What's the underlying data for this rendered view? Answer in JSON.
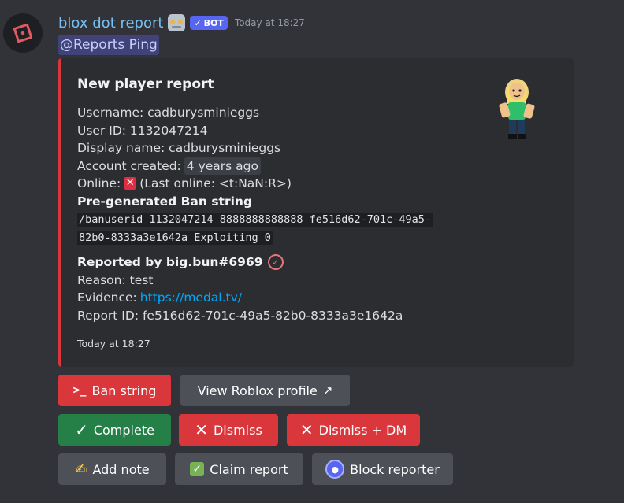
{
  "message": {
    "username": "blox dot report",
    "bot_tag": "BOT",
    "timestamp": "Today at 18:27",
    "mention": "@Reports Ping"
  },
  "embed": {
    "title": "New player report",
    "username_line": "Username: cadburysminieggs",
    "user_id_line": "User ID: 1132047214",
    "display_name_line": "Display name: cadburysminieggs",
    "account_created_label": "Account created:",
    "account_created_value": "4 years ago",
    "online_label": "Online:",
    "online_status": "(Last online: <t:NaN:R>)",
    "ban_field_title": "Pre-generated Ban string",
    "ban_code_line1": "/banuserid 1132047214 8888888888888 fe516d62-701c-49a5-",
    "ban_code_line2": "82b0-8333a3e1642a Exploiting 0",
    "reported_by": "Reported by big.bun#6969",
    "reason": "Reason: test",
    "evidence_label": "Evidence:",
    "evidence_link": "https://medal.tv/",
    "report_id": "Report ID: fe516d62-701c-49a5-82b0-8333a3e1642a",
    "footer": "Today at 18:27",
    "accent_color": "#da373c"
  },
  "buttons": {
    "ban_string": "Ban string",
    "view_profile": "View Roblox profile",
    "complete": "Complete",
    "dismiss": "Dismiss",
    "dismiss_dm": "Dismiss + DM",
    "add_note": "Add note",
    "claim_report": "Claim report",
    "block_reporter": "Block reporter"
  },
  "icons": {
    "ban": "terminal-prompt-icon",
    "profile": "external-link-icon",
    "complete": "check-icon",
    "dismiss": "x-icon",
    "note": "pencil-icon",
    "claim": "green-check-icon",
    "block": "shield-icon"
  }
}
